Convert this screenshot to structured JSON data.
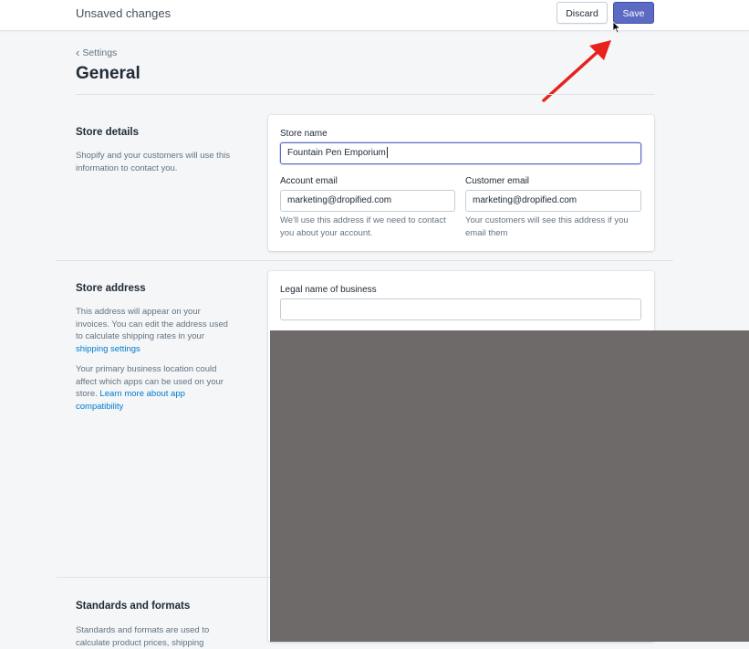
{
  "topbar": {
    "title": "Unsaved changes",
    "discard_label": "Discard",
    "save_label": "Save"
  },
  "breadcrumb": {
    "label": "Settings"
  },
  "page": {
    "title": "General"
  },
  "store_details": {
    "title": "Store details",
    "description": "Shopify and your customers will use this information to contact you.",
    "store_name_label": "Store name",
    "store_name_value": "Fountain Pen Emporium",
    "account_email_label": "Account email",
    "account_email_value": "marketing@dropified.com",
    "account_email_help": "We'll use this address if we need to contact you about your account.",
    "customer_email_label": "Customer email",
    "customer_email_value": "marketing@dropified.com",
    "customer_email_help": "Your customers will see this address if you email them"
  },
  "store_address": {
    "title": "Store address",
    "description_1_prefix": "This address will appear on your invoices. You can edit the address used to calculate shipping rates in your ",
    "description_1_link": "shipping settings",
    "description_2_prefix": "Your primary business location could affect which apps can be used on your store. ",
    "description_2_link": "Learn more about app compatibility",
    "legal_name_label": "Legal name of business",
    "legal_name_value": ""
  },
  "standards": {
    "title": "Standards and formats",
    "description": "Standards and formats are used to calculate product prices, shipping"
  },
  "colors": {
    "accent": "#5c6ac4",
    "link": "#007ace",
    "annotation_arrow": "#e8211d",
    "occluder": "#6e6a6a"
  }
}
